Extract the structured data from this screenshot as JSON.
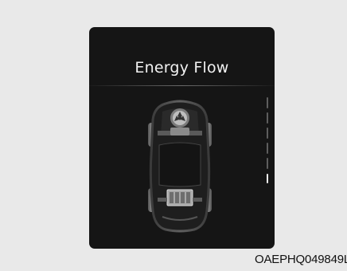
{
  "screen": {
    "title": "Energy Flow",
    "page_count": 6,
    "active_page": 6
  },
  "car": {
    "icon": "car-topdown-icon",
    "engine_icon": "engine-icon",
    "battery_icon": "battery-icon"
  },
  "figure_code": "OAEPHQ049849L",
  "colors": {
    "background": "#e9e9e9",
    "screen": "#151515",
    "text": "#f2f2f2"
  }
}
